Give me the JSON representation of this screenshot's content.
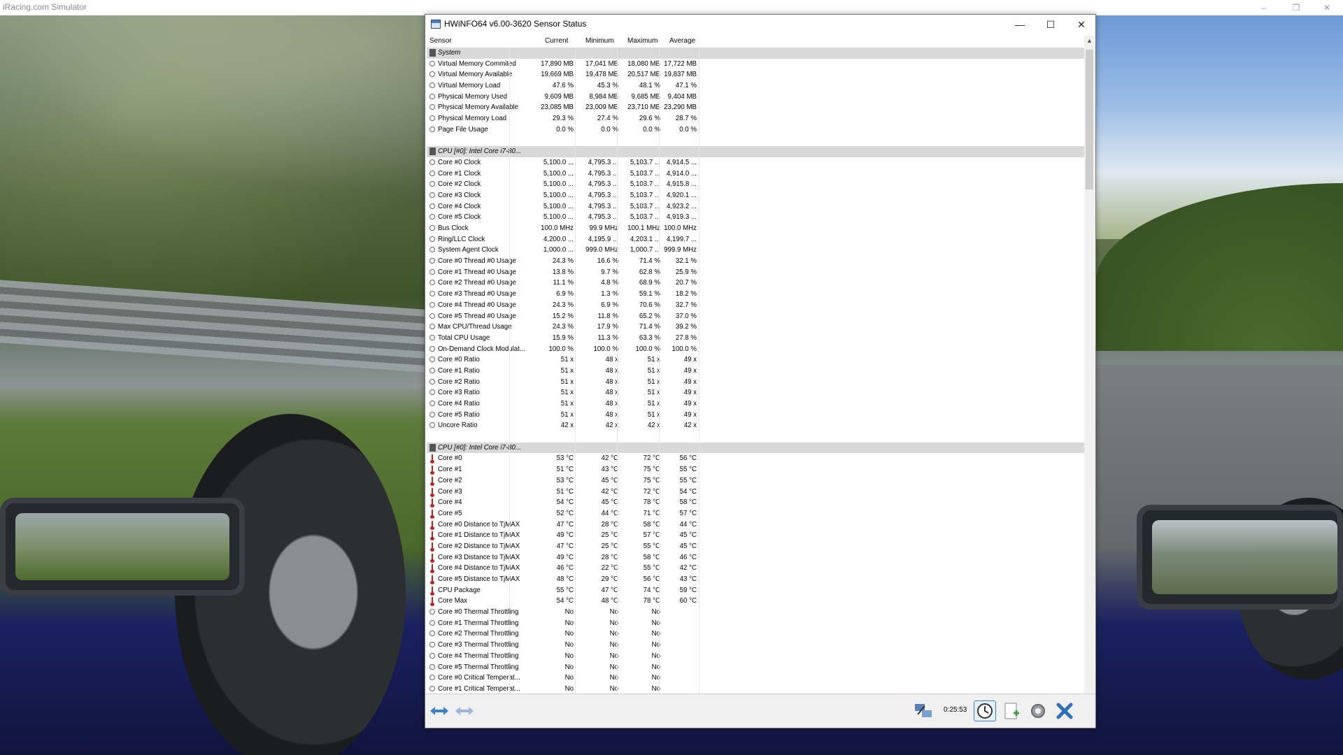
{
  "app": {
    "title": "iRacing.com Simulator",
    "minimize": "–",
    "restore": "❐",
    "close": "✕"
  },
  "window": {
    "title": "HWiNFO64 v6.00-3620 Sensor Status",
    "minimize": "—",
    "maximize": "☐",
    "close": "✕"
  },
  "columns": {
    "sensor": "Sensor",
    "current": "Current",
    "minimum": "Minimum",
    "maximum": "Maximum",
    "average": "Average"
  },
  "rows": [
    {
      "type": "section",
      "name": "System"
    },
    {
      "type": "sensor",
      "name": "Virtual Memory Commited",
      "cur": "17,890 MB",
      "min": "17,041 MB",
      "max": "18,080 MB",
      "avg": "17,722 MB"
    },
    {
      "type": "sensor",
      "name": "Virtual Memory Available",
      "cur": "19,669 MB",
      "min": "19,478 MB",
      "max": "20,517 MB",
      "avg": "19,837 MB"
    },
    {
      "type": "sensor",
      "name": "Virtual Memory Load",
      "cur": "47.6 %",
      "min": "45.3 %",
      "max": "48.1 %",
      "avg": "47.1 %"
    },
    {
      "type": "sensor",
      "name": "Physical Memory Used",
      "cur": "9,609 MB",
      "min": "8,984 MB",
      "max": "9,685 MB",
      "avg": "9,404 MB"
    },
    {
      "type": "sensor",
      "name": "Physical Memory Available",
      "cur": "23,085 MB",
      "min": "23,009 MB",
      "max": "23,710 MB",
      "avg": "23,290 MB"
    },
    {
      "type": "sensor",
      "name": "Physical Memory Load",
      "cur": "29.3 %",
      "min": "27.4 %",
      "max": "29.6 %",
      "avg": "28.7 %"
    },
    {
      "type": "sensor",
      "name": "Page File Usage",
      "cur": "0.0 %",
      "min": "0.0 %",
      "max": "0.0 %",
      "avg": "0.0 %"
    },
    {
      "type": "blank"
    },
    {
      "type": "section",
      "name": "CPU [#0]: Intel Core i7-80..."
    },
    {
      "type": "sensor",
      "name": "Core #0 Clock",
      "cur": "5,100.0 ...",
      "min": "4,795.3 ...",
      "max": "5,103.7 ...",
      "avg": "4,914.5 ..."
    },
    {
      "type": "sensor",
      "name": "Core #1 Clock",
      "cur": "5,100.0 ...",
      "min": "4,795.3 ...",
      "max": "5,103.7 ...",
      "avg": "4,914.0 ..."
    },
    {
      "type": "sensor",
      "name": "Core #2 Clock",
      "cur": "5,100.0 ...",
      "min": "4,795.3 ...",
      "max": "5,103.7 ...",
      "avg": "4,915.8 ..."
    },
    {
      "type": "sensor",
      "name": "Core #3 Clock",
      "cur": "5,100.0 ...",
      "min": "4,795.3 ...",
      "max": "5,103.7 ...",
      "avg": "4,920.1 ..."
    },
    {
      "type": "sensor",
      "name": "Core #4 Clock",
      "cur": "5,100.0 ...",
      "min": "4,795.3 ...",
      "max": "5,103.7 ...",
      "avg": "4,923.2 ..."
    },
    {
      "type": "sensor",
      "name": "Core #5 Clock",
      "cur": "5,100.0 ...",
      "min": "4,795.3 ...",
      "max": "5,103.7 ...",
      "avg": "4,919.3 ..."
    },
    {
      "type": "sensor",
      "name": "Bus Clock",
      "cur": "100.0 MHz",
      "min": "99.9 MHz",
      "max": "100.1 MHz",
      "avg": "100.0 MHz"
    },
    {
      "type": "sensor",
      "name": "Ring/LLC Clock",
      "cur": "4,200.0 ...",
      "min": "4,195.9 ...",
      "max": "4,203.1 ...",
      "avg": "4,199.7 ..."
    },
    {
      "type": "sensor",
      "name": "System Agent Clock",
      "cur": "1,000.0 ...",
      "min": "999.0 MHz",
      "max": "1,000.7 ...",
      "avg": "999.9 MHz"
    },
    {
      "type": "sensor",
      "name": "Core #0 Thread #0 Usage",
      "cur": "24.3 %",
      "min": "16.6 %",
      "max": "71.4 %",
      "avg": "32.1 %"
    },
    {
      "type": "sensor",
      "name": "Core #1 Thread #0 Usage",
      "cur": "13.8 %",
      "min": "9.7 %",
      "max": "62.8 %",
      "avg": "25.9 %"
    },
    {
      "type": "sensor",
      "name": "Core #2 Thread #0 Usage",
      "cur": "11.1 %",
      "min": "4.8 %",
      "max": "68.9 %",
      "avg": "20.7 %"
    },
    {
      "type": "sensor",
      "name": "Core #3 Thread #0 Usage",
      "cur": "6.9 %",
      "min": "1.3 %",
      "max": "59.1 %",
      "avg": "18.2 %"
    },
    {
      "type": "sensor",
      "name": "Core #4 Thread #0 Usage",
      "cur": "24.3 %",
      "min": "6.9 %",
      "max": "70.6 %",
      "avg": "32.7 %"
    },
    {
      "type": "sensor",
      "name": "Core #5 Thread #0 Usage",
      "cur": "15.2 %",
      "min": "11.8 %",
      "max": "65.2 %",
      "avg": "37.0 %"
    },
    {
      "type": "sensor",
      "name": "Max CPU/Thread Usage",
      "cur": "24.3 %",
      "min": "17.9 %",
      "max": "71.4 %",
      "avg": "39.2 %"
    },
    {
      "type": "sensor",
      "name": "Total CPU Usage",
      "cur": "15.9 %",
      "min": "11.3 %",
      "max": "63.3 %",
      "avg": "27.8 %"
    },
    {
      "type": "sensor",
      "name": "On-Demand Clock Modulat...",
      "cur": "100.0 %",
      "min": "100.0 %",
      "max": "100.0 %",
      "avg": "100.0 %"
    },
    {
      "type": "sensor",
      "name": "Core #0 Ratio",
      "cur": "51 x",
      "min": "48 x",
      "max": "51 x",
      "avg": "49 x"
    },
    {
      "type": "sensor",
      "name": "Core #1 Ratio",
      "cur": "51 x",
      "min": "48 x",
      "max": "51 x",
      "avg": "49 x"
    },
    {
      "type": "sensor",
      "name": "Core #2 Ratio",
      "cur": "51 x",
      "min": "48 x",
      "max": "51 x",
      "avg": "49 x"
    },
    {
      "type": "sensor",
      "name": "Core #3 Ratio",
      "cur": "51 x",
      "min": "48 x",
      "max": "51 x",
      "avg": "49 x"
    },
    {
      "type": "sensor",
      "name": "Core #4 Ratio",
      "cur": "51 x",
      "min": "48 x",
      "max": "51 x",
      "avg": "49 x"
    },
    {
      "type": "sensor",
      "name": "Core #5 Ratio",
      "cur": "51 x",
      "min": "48 x",
      "max": "51 x",
      "avg": "49 x"
    },
    {
      "type": "sensor",
      "name": "Uncore Ratio",
      "cur": "42 x",
      "min": "42 x",
      "max": "42 x",
      "avg": "42 x"
    },
    {
      "type": "blank"
    },
    {
      "type": "section",
      "name": "CPU [#0]: Intel Core i7-80..."
    },
    {
      "type": "temp",
      "name": "Core #0",
      "cur": "53 °C",
      "min": "42 °C",
      "max": "72 °C",
      "avg": "56 °C"
    },
    {
      "type": "temp",
      "name": "Core #1",
      "cur": "51 °C",
      "min": "43 °C",
      "max": "75 °C",
      "avg": "55 °C"
    },
    {
      "type": "temp",
      "name": "Core #2",
      "cur": "53 °C",
      "min": "45 °C",
      "max": "75 °C",
      "avg": "55 °C"
    },
    {
      "type": "temp",
      "name": "Core #3",
      "cur": "51 °C",
      "min": "42 °C",
      "max": "72 °C",
      "avg": "54 °C"
    },
    {
      "type": "temp",
      "name": "Core #4",
      "cur": "54 °C",
      "min": "45 °C",
      "max": "78 °C",
      "avg": "58 °C"
    },
    {
      "type": "temp",
      "name": "Core #5",
      "cur": "52 °C",
      "min": "44 °C",
      "max": "71 °C",
      "avg": "57 °C"
    },
    {
      "type": "temp",
      "name": "Core #0 Distance to TjMAX",
      "cur": "47 °C",
      "min": "28 °C",
      "max": "58 °C",
      "avg": "44 °C"
    },
    {
      "type": "temp",
      "name": "Core #1 Distance to TjMAX",
      "cur": "49 °C",
      "min": "25 °C",
      "max": "57 °C",
      "avg": "45 °C"
    },
    {
      "type": "temp",
      "name": "Core #2 Distance to TjMAX",
      "cur": "47 °C",
      "min": "25 °C",
      "max": "55 °C",
      "avg": "45 °C"
    },
    {
      "type": "temp",
      "name": "Core #3 Distance to TjMAX",
      "cur": "49 °C",
      "min": "28 °C",
      "max": "58 °C",
      "avg": "46 °C"
    },
    {
      "type": "temp",
      "name": "Core #4 Distance to TjMAX",
      "cur": "46 °C",
      "min": "22 °C",
      "max": "55 °C",
      "avg": "42 °C"
    },
    {
      "type": "temp",
      "name": "Core #5 Distance to TjMAX",
      "cur": "48 °C",
      "min": "29 °C",
      "max": "56 °C",
      "avg": "43 °C"
    },
    {
      "type": "temp",
      "name": "CPU Package",
      "cur": "55 °C",
      "min": "47 °C",
      "max": "74 °C",
      "avg": "59 °C"
    },
    {
      "type": "temp",
      "name": "Core Max",
      "cur": "54 °C",
      "min": "48 °C",
      "max": "78 °C",
      "avg": "60 °C"
    },
    {
      "type": "sensor",
      "name": "Core #0 Thermal Throttling",
      "cur": "No",
      "min": "No",
      "max": "No",
      "avg": ""
    },
    {
      "type": "sensor",
      "name": "Core #1 Thermal Throttling",
      "cur": "No",
      "min": "No",
      "max": "No",
      "avg": ""
    },
    {
      "type": "sensor",
      "name": "Core #2 Thermal Throttling",
      "cur": "No",
      "min": "No",
      "max": "No",
      "avg": ""
    },
    {
      "type": "sensor",
      "name": "Core #3 Thermal Throttling",
      "cur": "No",
      "min": "No",
      "max": "No",
      "avg": ""
    },
    {
      "type": "sensor",
      "name": "Core #4 Thermal Throttling",
      "cur": "No",
      "min": "No",
      "max": "No",
      "avg": ""
    },
    {
      "type": "sensor",
      "name": "Core #5 Thermal Throttling",
      "cur": "No",
      "min": "No",
      "max": "No",
      "avg": ""
    },
    {
      "type": "sensor",
      "name": "Core #0 Critical Temperat...",
      "cur": "No",
      "min": "No",
      "max": "No",
      "avg": ""
    },
    {
      "type": "sensor",
      "name": "Core #1 Critical Temperat...",
      "cur": "No",
      "min": "No",
      "max": "No",
      "avg": ""
    }
  ],
  "footer": {
    "timer": "0:25:53",
    "icons": [
      "back-forward-icon",
      "forward-back-icon",
      "network-icon",
      "clock-icon",
      "add-report-icon",
      "settings-icon",
      "close-icon"
    ]
  },
  "scrollbar": {
    "up": "▲",
    "down": "▼"
  }
}
